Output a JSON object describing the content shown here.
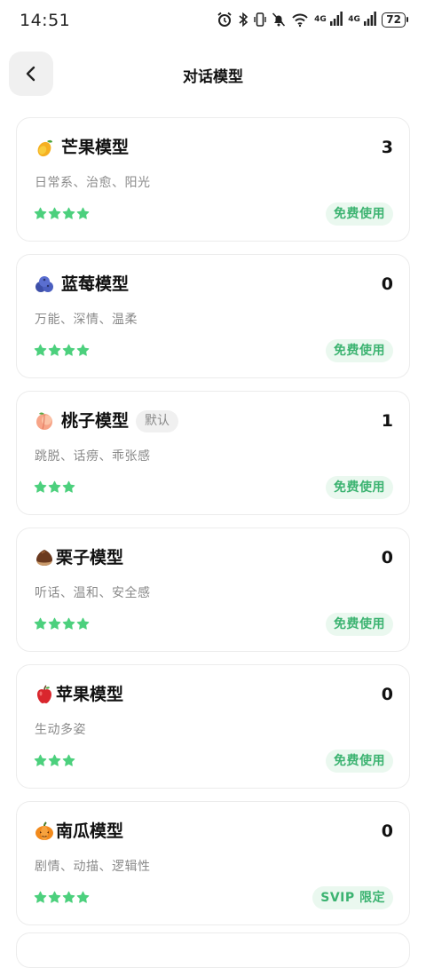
{
  "status": {
    "time": "14:51",
    "net1": "4G",
    "net2": "4G",
    "battery": "72"
  },
  "header": {
    "title": "对话模型"
  },
  "models": [
    {
      "icon": "mango-icon",
      "name": "芒果模型",
      "count": "3",
      "tags": "日常系、治愈、阳光",
      "stars": 4,
      "usage": "免费使用"
    },
    {
      "icon": "blueberry-icon",
      "name": "蓝莓模型",
      "count": "0",
      "tags": "万能、深情、温柔",
      "stars": 4,
      "usage": "免费使用"
    },
    {
      "icon": "peach-icon",
      "name": "桃子模型",
      "badge": "默认",
      "count": "1",
      "tags": "跳脱、话痨、乖张感",
      "stars": 3,
      "usage": "免费使用"
    },
    {
      "icon": "chestnut-icon",
      "name": "栗子模型",
      "count": "0",
      "tags": "听话、温和、安全感",
      "stars": 4,
      "usage": "免费使用"
    },
    {
      "icon": "apple-icon",
      "name": "苹果模型",
      "count": "0",
      "tags": "生动多姿",
      "stars": 3,
      "usage": "免费使用"
    },
    {
      "icon": "pumpkin-icon",
      "name": "南瓜模型",
      "count": "0",
      "tags": "剧情、动描、逻辑性",
      "stars": 4,
      "usage": "SVIP 限定"
    }
  ],
  "colors": {
    "accent_green": "#3cb371",
    "star_green": "#4cd07d",
    "badge_bg": "#eaf8ef"
  }
}
